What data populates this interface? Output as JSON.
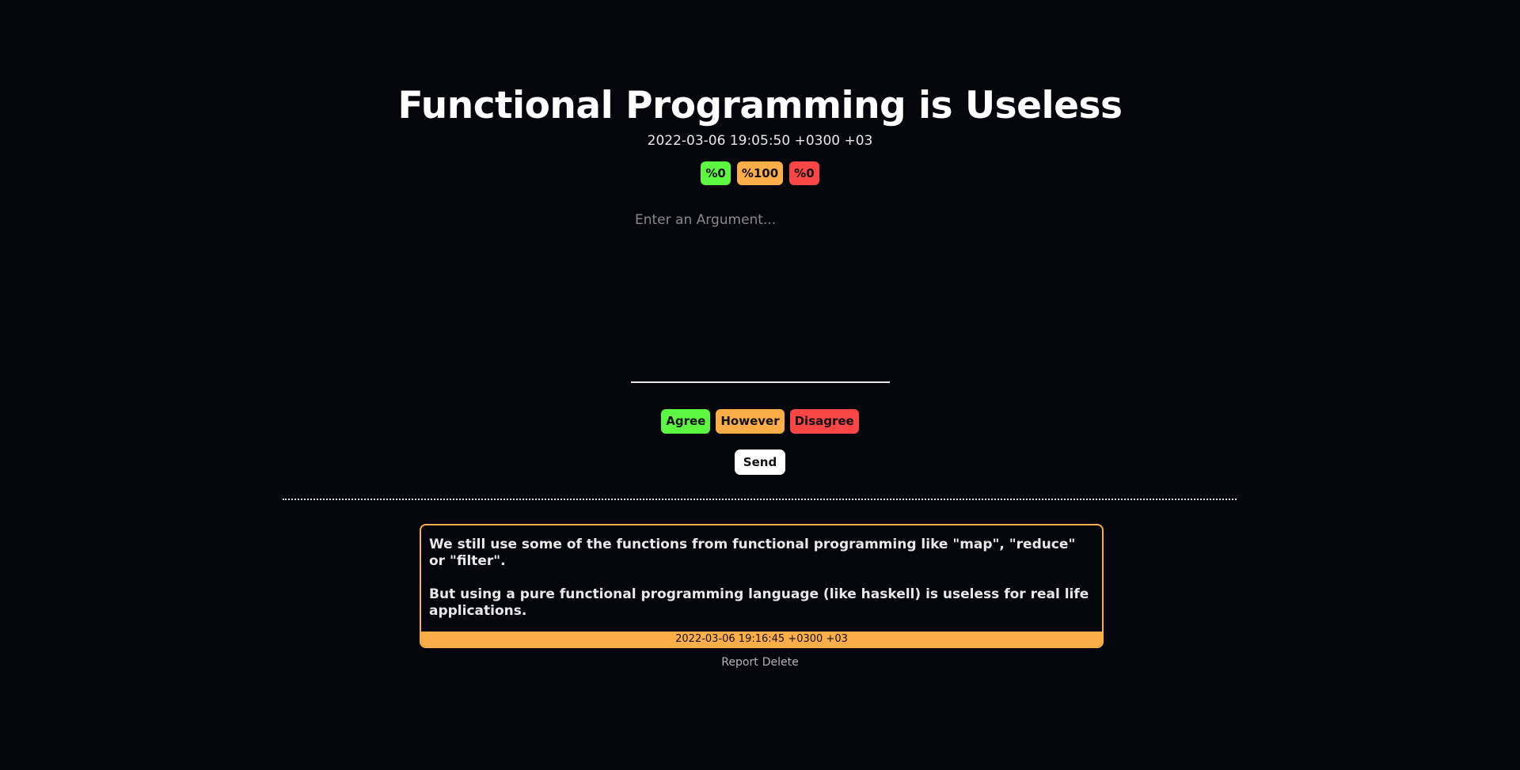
{
  "post": {
    "title": "Functional Programming is Useless",
    "date": "2022-03-06 19:05:50 +0300 +03",
    "stats": {
      "agree": "%0",
      "however": "%100",
      "disagree": "%0"
    }
  },
  "form": {
    "placeholder": "Enter an Argument...",
    "value": "",
    "agree_label": "Agree",
    "however_label": "However",
    "disagree_label": "Disagree",
    "send_label": "Send"
  },
  "arguments": [
    {
      "paragraphs": [
        "We still use some of the functions from functional programming like \"map\", \"reduce\" or \"filter\".",
        "But using a pure functional programming language (like haskell) is useless for real life applications."
      ],
      "date": "2022-03-06 19:16:45 +0300 +03",
      "report_label": "Report",
      "delete_label": "Delete"
    }
  ],
  "colors": {
    "agree": "#5cf740",
    "however": "#fbae47",
    "disagree": "#fb4646",
    "background": "#05060b"
  }
}
